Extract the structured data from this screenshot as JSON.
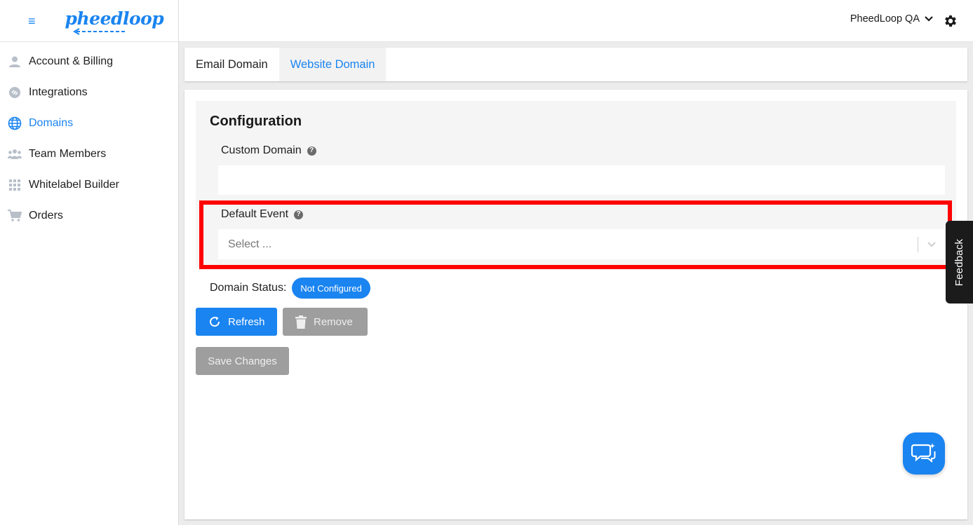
{
  "brand": {
    "logo_text": "pheedloop",
    "hamburger": "≡",
    "accent": "#1a84f0"
  },
  "sidebar": {
    "items": [
      {
        "label": "Account & Billing",
        "icon": "user-icon"
      },
      {
        "label": "Integrations",
        "icon": "integrations-icon"
      },
      {
        "label": "Domains",
        "icon": "globe-icon",
        "active": true
      },
      {
        "label": "Team Members",
        "icon": "team-icon"
      },
      {
        "label": "Whitelabel Builder",
        "icon": "grid-icon"
      },
      {
        "label": "Orders",
        "icon": "cart-icon"
      }
    ]
  },
  "header": {
    "account_name": "PheedLoop QA",
    "settings_icon": "gear-icon"
  },
  "tabs": [
    {
      "label": "Email Domain"
    },
    {
      "label": "Website Domain",
      "active": true
    }
  ],
  "config": {
    "title": "Configuration",
    "custom_domain": {
      "label": "Custom Domain",
      "value": "",
      "help": "?"
    },
    "default_event": {
      "label": "Default Event",
      "placeholder": "Select ...",
      "help": "?"
    },
    "status": {
      "label": "Domain Status:",
      "value": "Not Configured"
    }
  },
  "buttons": {
    "refresh": "Refresh",
    "remove": "Remove",
    "save": "Save Changes"
  },
  "feedback": {
    "label": "Feedback"
  },
  "colors": {
    "highlight": "#ff0000",
    "disabled": "#9e9e9e"
  }
}
